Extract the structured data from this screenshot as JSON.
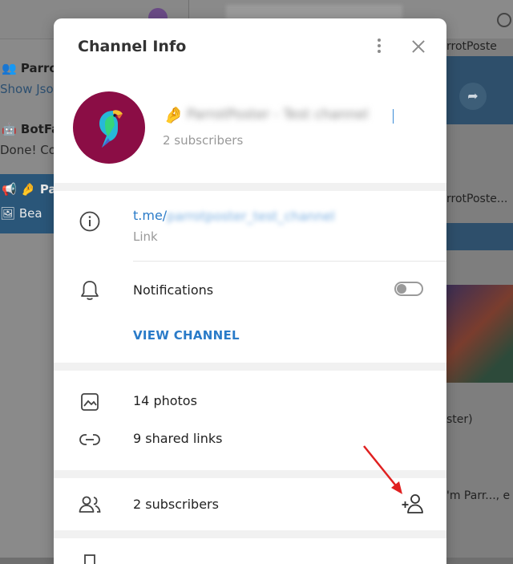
{
  "dialog": {
    "title": "Channel Info",
    "channel_emoji": "🤌",
    "channel_name": "ParrotPoster - Test channel",
    "subscriber_count_label": "2 subscribers",
    "link": {
      "prefix": "t.me/",
      "rest": "parrotposter_test_channel",
      "caption": "Link"
    },
    "notifications": {
      "label": "Notifications",
      "enabled": false
    },
    "view_channel_label": "VIEW CHANNEL",
    "media": {
      "photos": "14 photos",
      "links": "9 shared links"
    },
    "subscribers_row": "2 subscribers"
  },
  "background": {
    "chats": [
      {
        "name": "Parrot",
        "preview": "Show Json"
      },
      {
        "name": "BotFat",
        "preview": "Done! Con"
      },
      {
        "name": "Pa",
        "preview": "Bea"
      }
    ],
    "right_texts": [
      "rrotPoste",
      "rrotPoste...",
      "ster)",
      "'m Parr..., e"
    ]
  },
  "colors": {
    "accent": "#2a7bc8",
    "avatar_bg": "#8b0d45",
    "annotation_arrow": "#e02020"
  }
}
